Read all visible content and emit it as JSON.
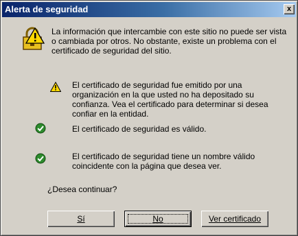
{
  "window": {
    "title": "Alerta de seguridad",
    "close_glyph": "x"
  },
  "intro_text": "La información que intercambie con este sitio no puede ser vista o cambiada por otros. No obstante, existe un problema con el certificado de seguridad del sitio.",
  "items": [
    {
      "icon": "warning-icon",
      "text": "El certificado de seguridad fue emitido por una organización en la que usted no ha depositado su confianza. Vea el certificado para determinar si desea confiar en la entidad."
    },
    {
      "icon": "check-icon",
      "text": "El certificado de seguridad es válido."
    },
    {
      "icon": "check-icon",
      "text": "El certificado de seguridad tiene un nombre válido coincidente con la página que desea ver."
    }
  ],
  "question": "¿Desea continuar?",
  "buttons": {
    "yes": "Sí",
    "no": "No",
    "view_cert": "Ver certificado"
  },
  "colors": {
    "title_start": "#0a246a",
    "title_end": "#a6caf0",
    "dialog_face": "#d4d0c8",
    "warning_yellow": "#ffd800",
    "check_green": "#2e8b2e"
  }
}
